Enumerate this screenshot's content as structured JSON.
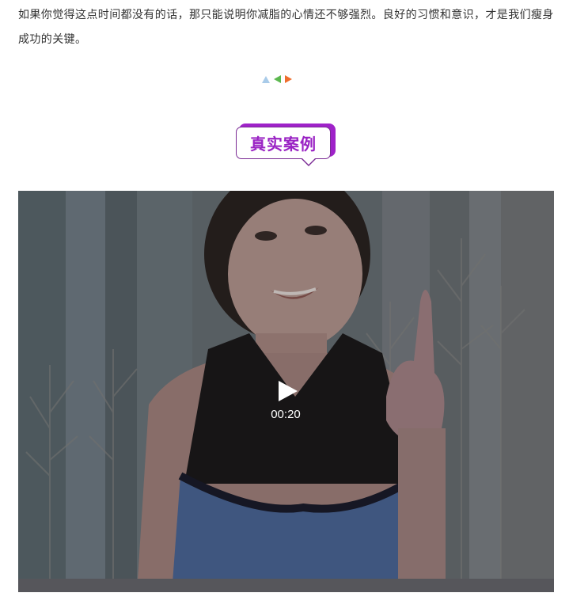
{
  "article": {
    "paragraph": "如果你觉得这点时间都没有的话，那只能说明你减脂的心情还不够强烈。良好的习惯和意识，才是我们瘦身成功的关键。"
  },
  "divider": {
    "icons": [
      "triangle-up-icon",
      "triangle-left-icon",
      "triangle-right-icon"
    ],
    "colors": {
      "up": "#a9cbe9",
      "left": "#5cb84f",
      "right": "#ef6d2d"
    }
  },
  "section_badge": {
    "label": "真实案例",
    "color": "#9a23c4"
  },
  "video": {
    "duration": "00:20",
    "play_icon": "play-icon"
  }
}
